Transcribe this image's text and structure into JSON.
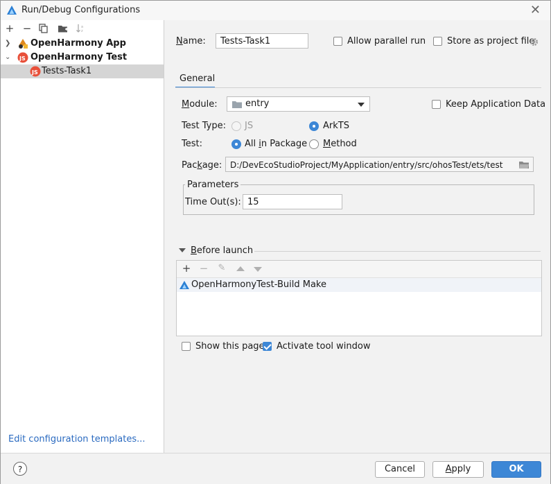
{
  "window": {
    "title": "Run/Debug Configurations"
  },
  "left": {
    "edit_templates": "Edit configuration templates...",
    "tree": [
      {
        "label": "OpenHarmony App"
      },
      {
        "label": "OpenHarmony Test"
      },
      {
        "label": "Tests-Task1"
      }
    ]
  },
  "form": {
    "name_label": "Name:",
    "name_value": "Tests-Task1",
    "allow_parallel": "Allow parallel run",
    "store_project": "Store as project file",
    "tab_general": "General",
    "module_label": "Module:",
    "module_value": "entry",
    "keep_app_data": "Keep Application Data",
    "test_type_label": "Test Type:",
    "test_type_js": "JS",
    "test_type_arkts": "ArkTS",
    "test_label": "Test:",
    "test_all_in_package": "All in Package",
    "test_method": "Method",
    "package_label": "Package:",
    "package_value": "D:/DevEcoStudioProject/MyApplication/entry/src/ohosTest/ets/test",
    "parameters_title": "Parameters",
    "timeout_label": "Time Out(s):",
    "timeout_value": "15",
    "before_launch_title": "Before launch",
    "before_launch_item": "OpenHarmonyTest-Build Make",
    "show_page": "Show this page",
    "activate_tool": "Activate tool window"
  },
  "buttons": {
    "cancel": "Cancel",
    "apply": "Apply",
    "ok": "OK",
    "help": "?"
  },
  "colors": {
    "accent": "#3d87d6",
    "link": "#2a6ac0",
    "js_icon": "#e8503a"
  }
}
